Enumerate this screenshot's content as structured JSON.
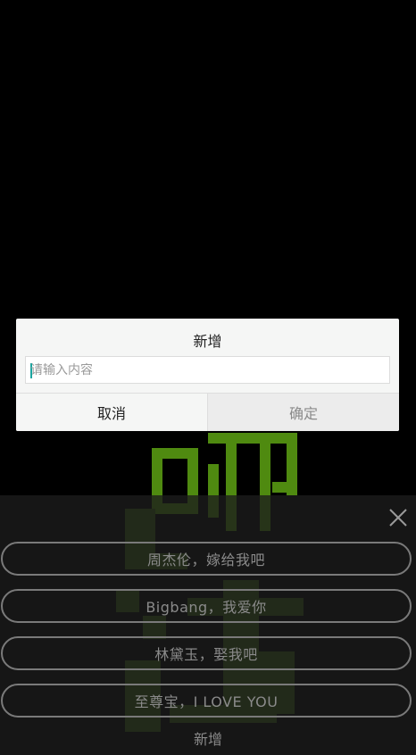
{
  "dialog": {
    "title": "新增",
    "input_placeholder": "请输入内容",
    "input_value": "",
    "cancel_label": "取消",
    "confirm_label": "确定"
  },
  "sheet": {
    "close_icon": "close-icon",
    "options": [
      {
        "label": "周杰伦，嫁给我吧"
      },
      {
        "label": "Bigbang，我爱你"
      },
      {
        "label": "林黛玉，娶我吧"
      },
      {
        "label": "至尊宝，I LOVE YOU"
      }
    ],
    "add_label": "新增"
  },
  "colors": {
    "background": "#000000",
    "glyph_green": "#4f8a10",
    "dialog_bg": "#f5f6f5",
    "caret": "#1aa5a0"
  }
}
